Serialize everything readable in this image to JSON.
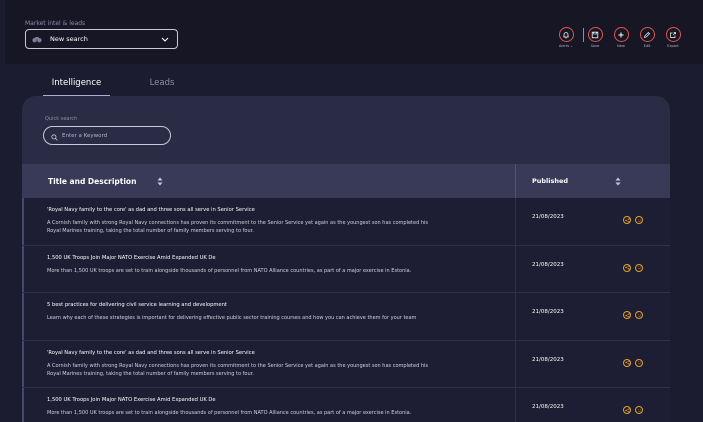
{
  "header": {
    "context_label": "Market intel & leads",
    "context_value": "New search",
    "actions": [
      {
        "name": "alerts",
        "label": "Alerts ⌄"
      },
      {
        "name": "save",
        "label": "Save"
      },
      {
        "name": "new",
        "label": "New"
      },
      {
        "name": "edit",
        "label": "Edit"
      },
      {
        "name": "export",
        "label": "Export"
      }
    ]
  },
  "tabs": [
    {
      "label": "Intelligence",
      "active": true
    },
    {
      "label": "Leads",
      "active": false
    }
  ],
  "quick_search": {
    "label": "Quick search",
    "placeholder": "Enter a Keyword"
  },
  "table": {
    "columns": [
      "Title and Description",
      "Published"
    ],
    "rows": [
      {
        "title": "'Royal Navy family to the core' as dad and three sons all serve in Senior Service",
        "description": "A Cornish family with strong Royal Navy connections has proven its commitment to the Senior Service yet again as the youngest son has completed his Royal Marines training, taking the total number of family members serving to four.",
        "published": "21/08/2023"
      },
      {
        "title": "1,500 UK Troops Join Major NATO Exercise Amid Expanded UK De",
        "description": "More than 1,500 UK troops are set to train alongside thousands of personnel from NATO Alliance countries, as part of a major exercise in Estonia.",
        "published": "21/08/2023"
      },
      {
        "title": "5 best practices for delivering civil service learning and development",
        "description": "Learn why each of these strategies is important for delivering effective public sector training courses and how you can achieve them for your team",
        "published": "21/08/2023"
      },
      {
        "title": "'Royal Navy family to the core' as dad and three sons all serve in Senior Service",
        "description": "A Cornish family with strong Royal Navy connections has proven its commitment to the Senior Service yet again as the youngest son has completed his Royal Marines training, taking the total number of family members serving to four.",
        "published": "21/08/2023"
      },
      {
        "title": "1,500 UK Troops Join Major NATO Exercise Amid Expanded UK De",
        "description": "More than 1,500 UK troops are set to train alongside thousands of personnel from NATO Alliance countries, as part of a major exercise in Estonia.",
        "published": "21/08/2023"
      }
    ]
  },
  "colors": {
    "background": "#1c1c30",
    "header_bg": "#161625",
    "panel_bg": "#2a2b45",
    "table_header_bg": "#393a57",
    "row_bg": "#1d1d33",
    "action_accent": "#e0544d",
    "row_icon_accent": "#e2a12a"
  },
  "icons": {
    "context": "binoculars-icon",
    "alerts": "bell-icon",
    "save": "save-icon",
    "new": "plus-icon",
    "edit": "pencil-icon",
    "export": "export-icon",
    "search": "search-icon",
    "sort": "sort-icon",
    "row_share": "share-icon",
    "row_rate": "smiley-icon"
  }
}
